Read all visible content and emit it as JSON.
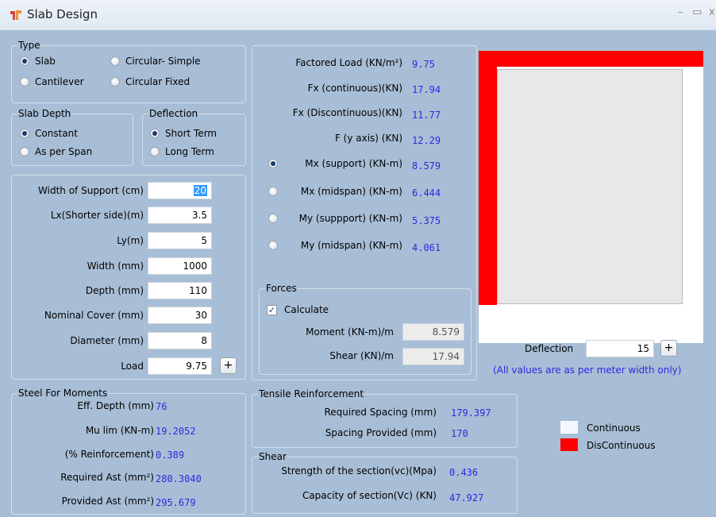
{
  "window": {
    "title": "Slab Design",
    "minimize": "–",
    "maximize": "▭",
    "close": "x"
  },
  "type_group": {
    "legend": "Type",
    "options": [
      "Slab",
      "Circular- Simple",
      "Cantilever",
      "Circular Fixed"
    ]
  },
  "slab_depth_group": {
    "legend": "Slab Depth",
    "options": [
      "Constant",
      "As per Span"
    ]
  },
  "deflection_group": {
    "legend": "Deflection",
    "options": [
      "Short Term",
      "Long Term"
    ]
  },
  "inputs": {
    "width_support_label": "Width of Support (cm)",
    "width_support_value": "20",
    "lx_label": "Lx(Shorter side)(m)",
    "lx_value": "3.5",
    "ly_label": "Ly(m)",
    "ly_value": "5",
    "width_label": "Width  (mm)",
    "width_value": "1000",
    "depth_label": "Depth (mm)",
    "depth_value": "110",
    "cover_label": "Nominal Cover (mm)",
    "cover_value": "30",
    "diameter_label": "Diameter (mm)",
    "diameter_value": "8",
    "load_label": "Load",
    "load_value": "9.75",
    "plus": "+"
  },
  "results": {
    "factored_load_label": "Factored Load  (KN/m²)",
    "factored_load_value": "9.75",
    "fx_cont_label": "Fx (continuous)(KN)",
    "fx_cont_value": "17.94",
    "fx_discont_label": "Fx (Discontinuous)(KN)",
    "fx_discont_value": "11.77",
    "fy_label": "F (y axis) (KN)",
    "fy_value": "12.29",
    "mx_support_label": "Mx (support) (KN-m)",
    "mx_support_value": "8.579",
    "mx_mid_label": "Mx (midspan) (KN-m)",
    "mx_mid_value": "6.444",
    "my_support_label": "My (suppport) (KN-m)",
    "my_support_value": "5.375",
    "my_mid_label": "My (midspan) (KN-m)",
    "my_mid_value": "4.061"
  },
  "forces": {
    "legend": "Forces",
    "calculate_label": "Calculate",
    "check": "✓",
    "moment_label": "Moment (KN-m)/m",
    "moment_value": "8.579",
    "shear_label": "Shear (KN)/m",
    "shear_value": "17.94"
  },
  "deflection_input": {
    "label": "Deflection",
    "value": "15",
    "plus": "+",
    "note": "(All values are as per meter width only)"
  },
  "steel": {
    "legend": "Steel For Moments",
    "eff_depth_label": "Eff. Depth (mm)",
    "eff_depth_value": "76",
    "mu_lim_label": "Mu lim (KN-m)",
    "mu_lim_value": "19.2052",
    "pct_label": "(% Reinforcement)",
    "pct_value": "0.389",
    "req_ast_label": "Required  Ast (mm²)",
    "req_ast_value": "280.3040",
    "prov_ast_label": "Provided  Ast (mm²)",
    "prov_ast_value": "295.679"
  },
  "tensile": {
    "legend": "Tensile Reinforcement",
    "req_spacing_label": "Required Spacing (mm)",
    "req_spacing_value": "179.397",
    "prov_spacing_label": "Spacing Provided (mm)",
    "prov_spacing_value": "170"
  },
  "shear": {
    "legend": "Shear",
    "strength_label": "Strength of the section(vc)(Mpa)",
    "strength_value": "0.436",
    "capacity_label": "Capacity of section(Vc) (KN)",
    "capacity_value": "47.927"
  },
  "key": {
    "continuous": "Continuous",
    "discontinuous": "DisContinuous",
    "continuous_color": "#f2f8fd",
    "discontinuous_color": "#ff0000"
  }
}
